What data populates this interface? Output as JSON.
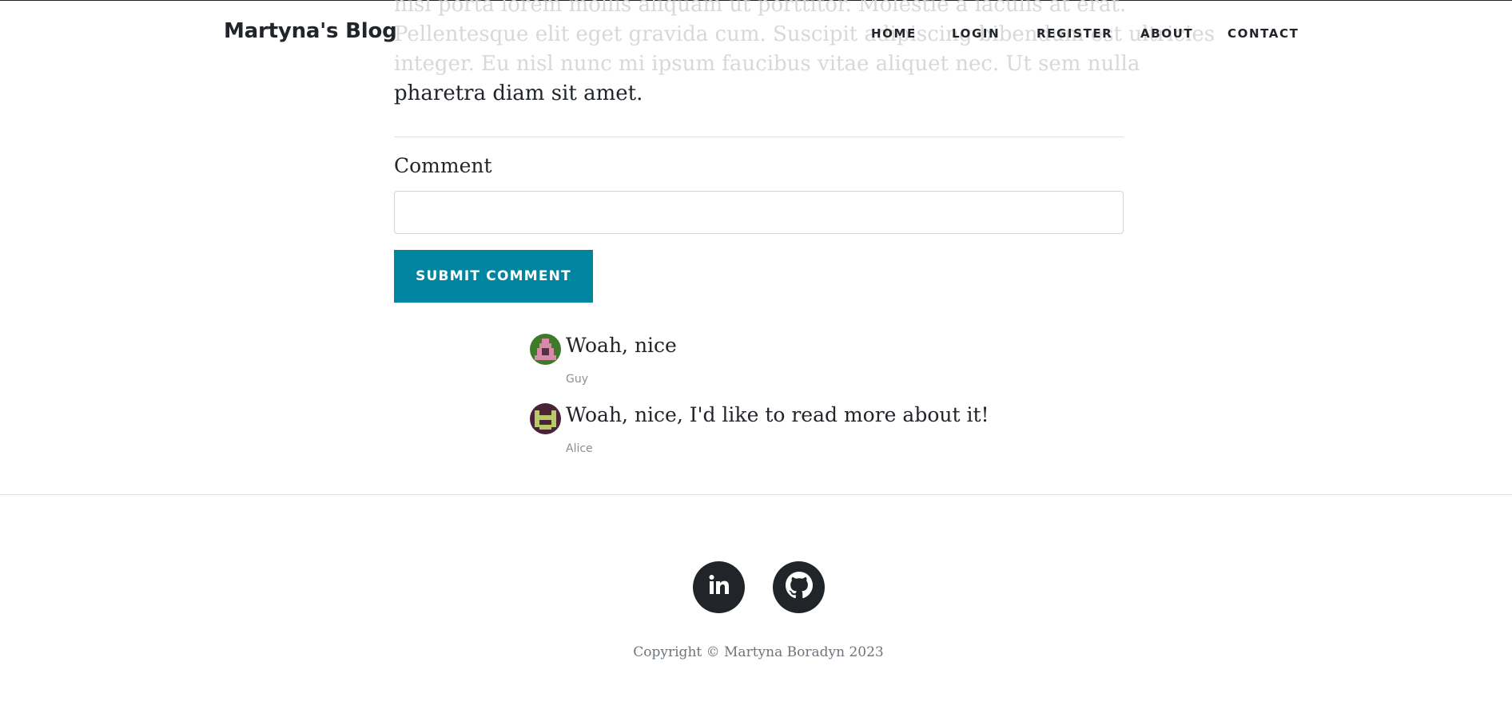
{
  "brand": "Martyna's Blog",
  "nav": {
    "home": "Home",
    "login": "Login",
    "register": "Register",
    "about": "About",
    "contact": "Contact"
  },
  "article": {
    "faded_lines": [
      "nisl porta lorem mollis aliquam ut porttitor. Molestie a iaculis at erat.",
      "Pellentesque elit eget gravida cum. Suscipit adipiscing bibendum est ultricies",
      "integer. Eu nisl nunc mi ipsum faucibus vitae aliquet nec. Ut sem nulla"
    ],
    "last_line": "pharetra diam sit amet."
  },
  "comment_form": {
    "label": "Comment",
    "input_value": "",
    "submit_label": "Submit Comment"
  },
  "comments": [
    {
      "text": "Woah, nice",
      "author": "Guy"
    },
    {
      "text": "Woah, nice, I'd like to read more about it!",
      "author": "Alice"
    }
  ],
  "footer": {
    "social": [
      {
        "icon": "linkedin-icon"
      },
      {
        "icon": "github-icon"
      }
    ],
    "copyright": "Copyright © Martyna Boradyn 2023"
  },
  "colors": {
    "accent": "#0085a1",
    "text": "#212529",
    "muted": "#6c757d"
  }
}
